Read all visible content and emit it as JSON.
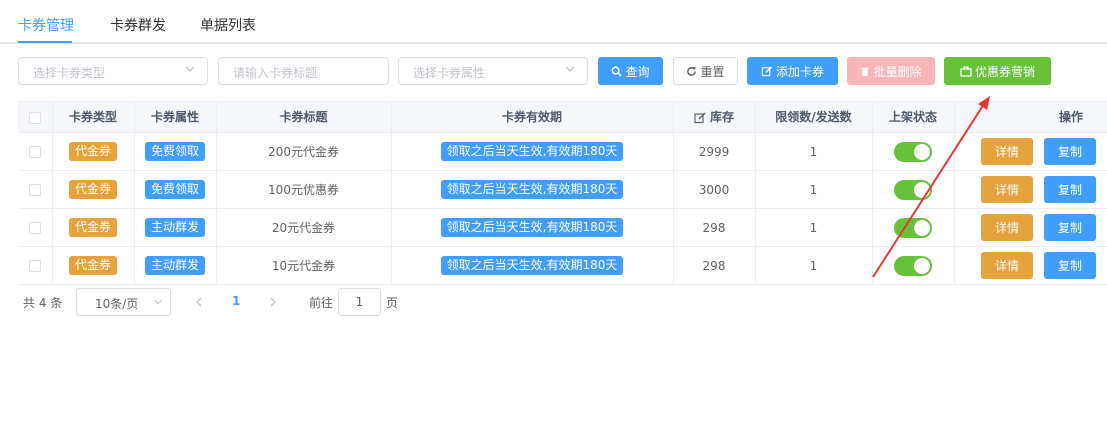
{
  "tabs": [
    {
      "label": "卡券管理",
      "active": true
    },
    {
      "label": "卡券群发",
      "active": false
    },
    {
      "label": "单据列表",
      "active": false
    }
  ],
  "filters": {
    "type_placeholder": "选择卡券类型",
    "title_placeholder": "请输入卡券标题",
    "attr_placeholder": "选择卡券属性"
  },
  "toolbar": {
    "query_label": "查询",
    "reset_label": "重置",
    "add_label": "添加卡券",
    "batch_delete_label": "批量删除",
    "marketing_label": "优惠券营销"
  },
  "table": {
    "headers": {
      "type": "卡券类型",
      "attr": "卡券属性",
      "title": "卡券标题",
      "validity": "卡券有效期",
      "stock": "库存",
      "limit": "限领数/发送数",
      "status": "上架状态",
      "ops": "操作"
    },
    "rows": [
      {
        "type": "代金券",
        "attr": "免费领取",
        "attr_color": "blue",
        "title": "200元代金券",
        "validity": "领取之后当天生效,有效期180天",
        "stock": "2999",
        "limit": "1",
        "on": true
      },
      {
        "type": "代金券",
        "attr": "免费领取",
        "attr_color": "blue",
        "title": "100元优惠券",
        "validity": "领取之后当天生效,有效期180天",
        "stock": "3000",
        "limit": "1",
        "on": true
      },
      {
        "type": "代金券",
        "attr": "主动群发",
        "attr_color": "blue",
        "title": "20元代金券",
        "validity": "领取之后当天生效,有效期180天",
        "stock": "298",
        "limit": "1",
        "on": true
      },
      {
        "type": "代金券",
        "attr": "主动群发",
        "attr_color": "blue",
        "title": "10元代金券",
        "validity": "领取之后当天生效,有效期180天",
        "stock": "298",
        "limit": "1",
        "on": true
      }
    ],
    "detail_label": "详情",
    "copy_label": "复制"
  },
  "pagination": {
    "total_text": "共 4 条",
    "page_size": "10条/页",
    "current_page": "1",
    "goto_prefix": "前往",
    "goto_value": "1",
    "goto_suffix": "页"
  },
  "colors": {
    "primary": "#409eff",
    "success": "#67c23a",
    "warning": "#e6a23c",
    "danger_disabled": "#fab6b6",
    "annotation_arrow": "#e53935"
  }
}
